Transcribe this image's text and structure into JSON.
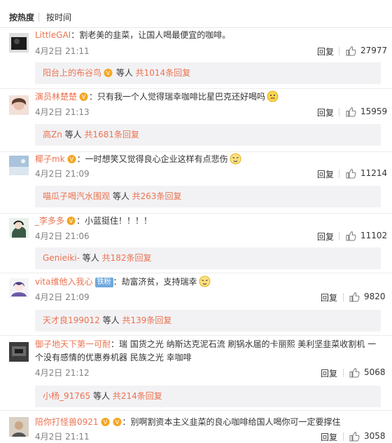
{
  "tabs": {
    "hot": "按热度",
    "time": "按时间"
  },
  "actions": {
    "reply": "回复"
  },
  "comments": [
    {
      "user": "LittleGAI",
      "text": "：割老美的韭菜，让国人喝最便宜的咖啡。",
      "time": "4月2日 21:11",
      "likes": "27977",
      "sub": {
        "name": "阳台上的布谷鸟",
        "mid": " 等人 ",
        "count": "共1014条回复"
      }
    },
    {
      "user": "演员林楚楚",
      "text": "：只有我一个人觉得瑞幸咖啡比星巴克还好喝吗",
      "time": "4月2日 21:13",
      "likes": "15959",
      "sub": {
        "name": "高Zn",
        "mid": " 等人 ",
        "count": "共1681条回复"
      }
    },
    {
      "user": "椰子mk",
      "text": "：一时想笑又觉得良心企业这样有点悲伤",
      "time": "4月2日 21:09",
      "likes": "11214",
      "sub": {
        "name": "喵瓜子喝汽水围观",
        "mid": " 等人 ",
        "count": "共263条回复"
      }
    },
    {
      "user": "_李多多",
      "text": "：小蓝挺住！！！！",
      "time": "4月2日 21:06",
      "likes": "11102",
      "sub": {
        "name": "Genieiki-",
        "mid": " 等人 ",
        "count": "共182条回复"
      }
    },
    {
      "user": "vita维他入我心",
      "badge": "铁粉",
      "text": "：劫富济贫，支持瑞幸",
      "time": "4月2日 21:09",
      "likes": "9820",
      "sub": {
        "name": "天才良199012",
        "mid": " 等人 ",
        "count": "共139条回复"
      }
    },
    {
      "user": "御子地天下第一可耐",
      "text": "：瑞 国货之光 纳斯达克泥石流 刷锅水届的卡丽熙 美利坚韭菜收割机 一个没有感情的优惠券机器 民族之光 幸咖啡",
      "time": "4月2日 21:12",
      "likes": "5068",
      "sub": {
        "name": "小杨_91765",
        "mid": " 等人 ",
        "count": "共214条回复"
      }
    },
    {
      "user": "陪你打怪兽0921",
      "text": "：别啊割资本主义韭菜的良心咖啡给国人喝你可一定要撑住",
      "time": "4月2日 21:11",
      "likes": "3058"
    }
  ],
  "colors": {
    "accent": "#eb7350",
    "meta": "#808080",
    "subBg": "#f2f2f5"
  },
  "icons": [
    "vip-crown-icon",
    "thumbs-up-icon",
    "emoji-face-icon"
  ]
}
